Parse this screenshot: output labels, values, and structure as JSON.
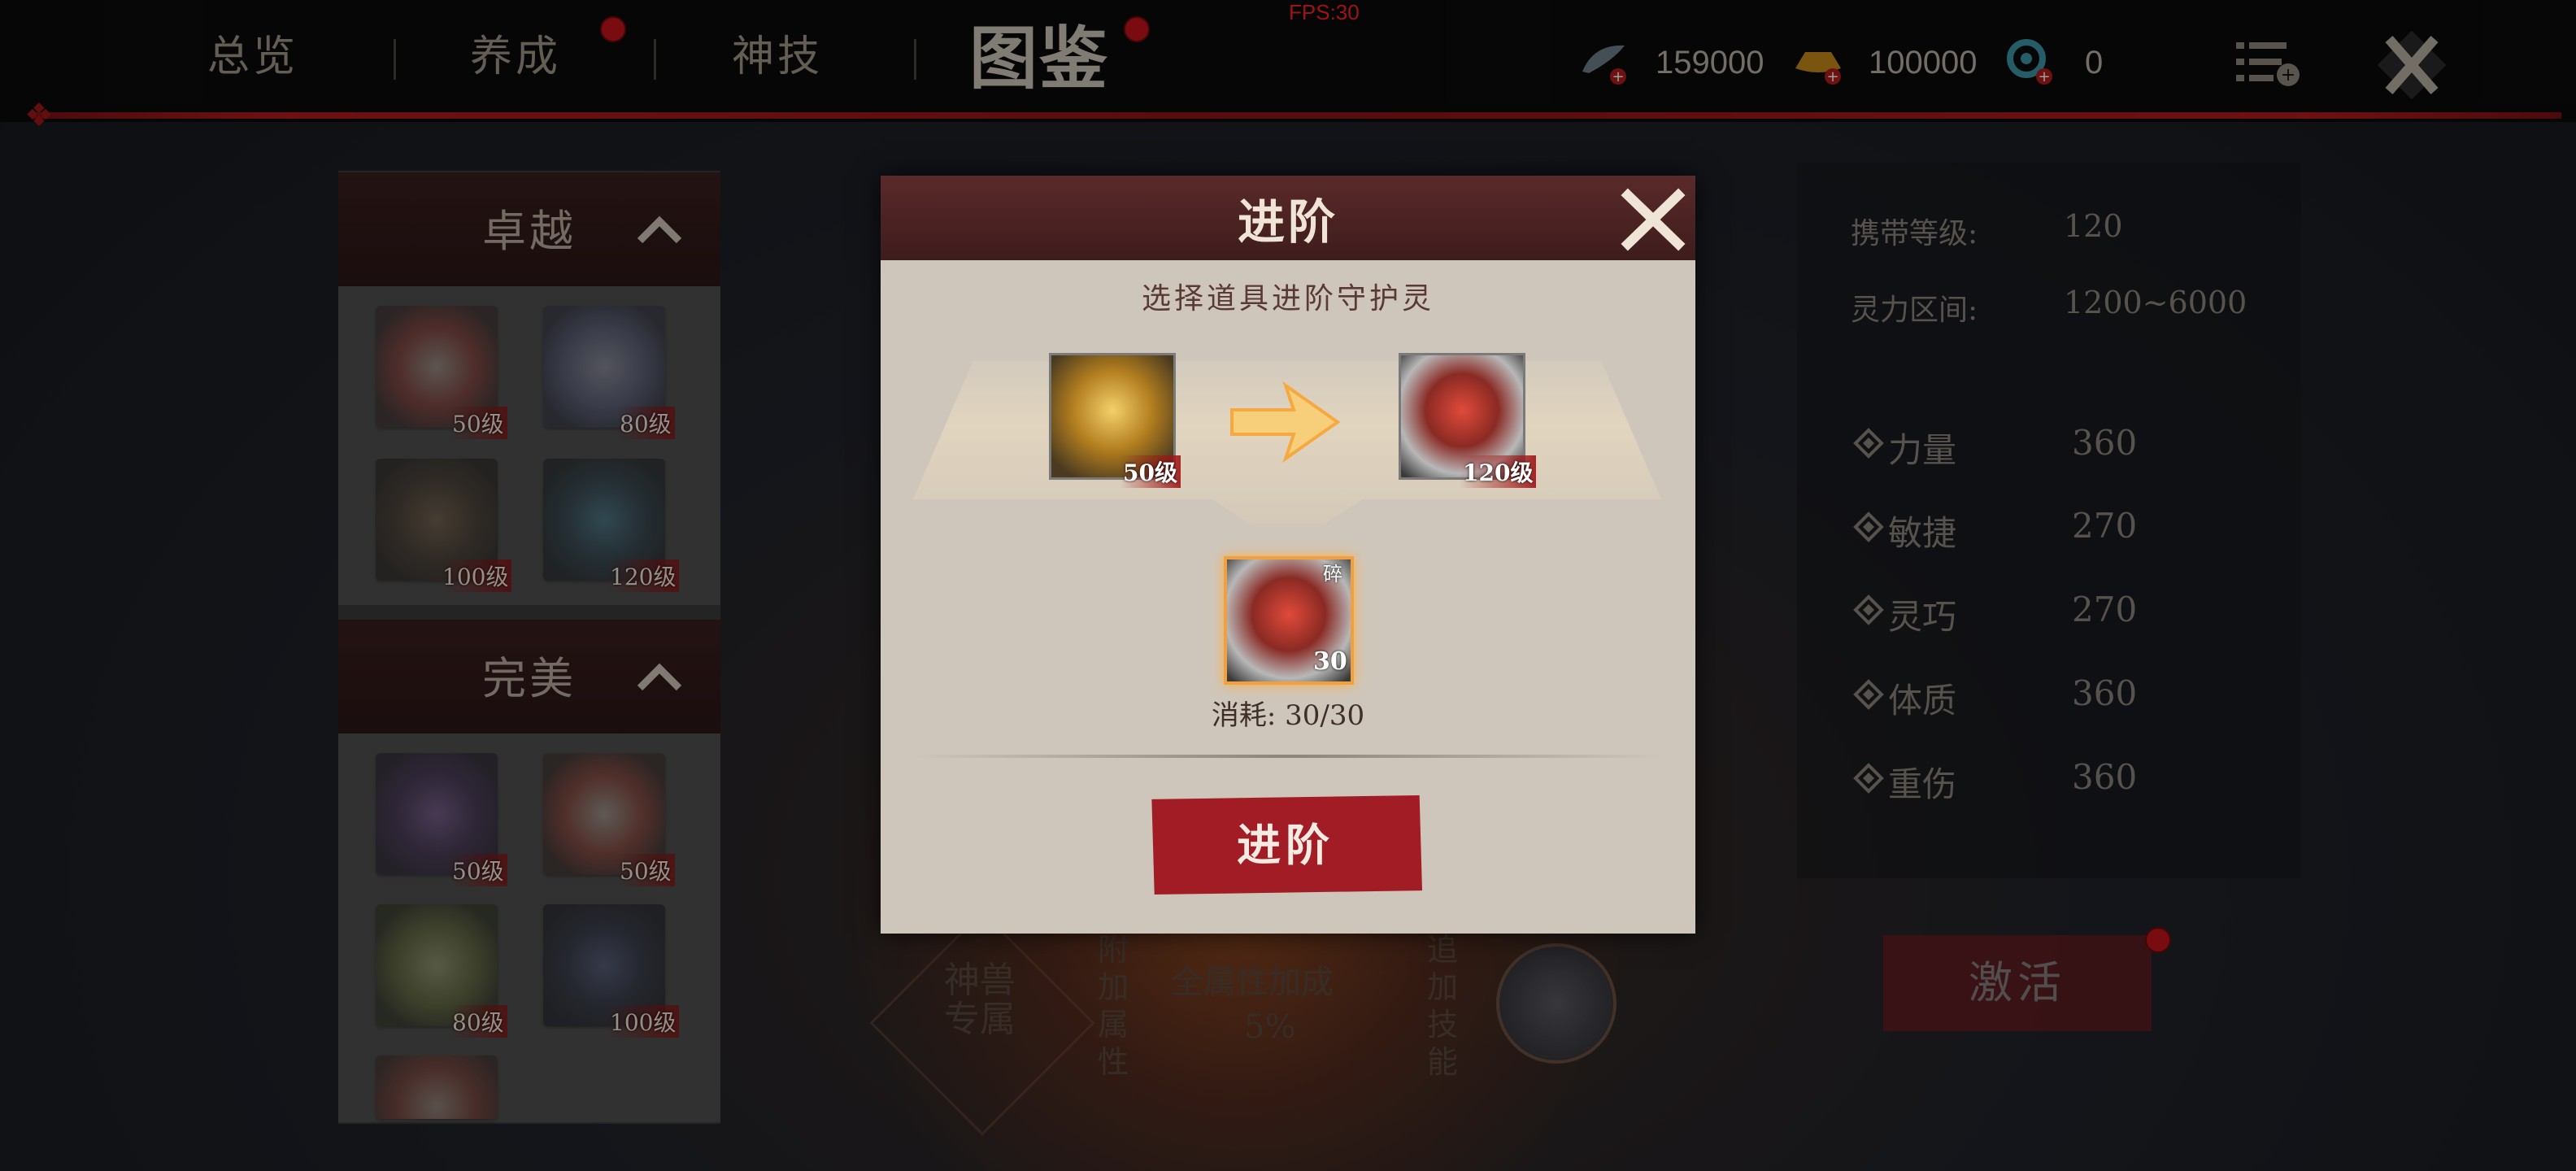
{
  "fps": "FPS:30",
  "tabs": [
    {
      "label": "总览",
      "dot": false
    },
    {
      "label": "养成",
      "dot": true
    },
    {
      "label": "神技",
      "dot": false
    },
    {
      "label": "图鉴",
      "dot": true
    }
  ],
  "currencies": [
    {
      "icon": "feather-icon",
      "value": "159000",
      "color": "#7a8a95"
    },
    {
      "icon": "gold-ingot-icon",
      "value": "100000",
      "color": "#c8921c"
    },
    {
      "icon": "gear-eye-icon",
      "value": "0",
      "color": "#3aa0b0"
    }
  ],
  "left_panel": {
    "sections": [
      {
        "title": "卓越",
        "cards": [
          {
            "level": "50级",
            "art": "white-red-beast"
          },
          {
            "level": "80级",
            "art": "blue-spirit-beast"
          },
          {
            "level": "100级",
            "art": "dark-brown-beast"
          },
          {
            "level": "120级",
            "art": "dark-teal-beast"
          }
        ]
      },
      {
        "title": "完美",
        "cards": [
          {
            "level": "50级",
            "art": "purple-dragon"
          },
          {
            "level": "50级",
            "art": "lion-dance"
          },
          {
            "level": "80级",
            "art": "green-beast"
          },
          {
            "level": "100级",
            "art": "dark-blue-dragon"
          },
          {
            "level": "",
            "art": "red-beast-partial"
          }
        ]
      }
    ]
  },
  "stats": {
    "carry_level_label": "携带等级:",
    "carry_level_value": "120",
    "power_range_label": "灵力区间:",
    "power_range_value": "1200~6000",
    "attributes": [
      {
        "name": "力量",
        "value": "360"
      },
      {
        "name": "敏捷",
        "value": "270"
      },
      {
        "name": "灵巧",
        "value": "270"
      },
      {
        "name": "体质",
        "value": "360"
      },
      {
        "name": "重伤",
        "value": "360"
      }
    ],
    "activate_label": "激活"
  },
  "beast_section": {
    "badge": "神兽专属",
    "extra_attr_label": "附加属性",
    "all_attr_bonus": "全属性加成",
    "bonus_value": "5%",
    "extra_skill_label": "追加技能"
  },
  "modal": {
    "title": "进阶",
    "subtitle": "选择道具进阶守护灵",
    "from_level": "50级",
    "to_level": "120级",
    "material_count": "30",
    "material_tag": "碎",
    "consume_label": "消耗:",
    "consume_value": "30/30",
    "button_label": "进阶"
  }
}
